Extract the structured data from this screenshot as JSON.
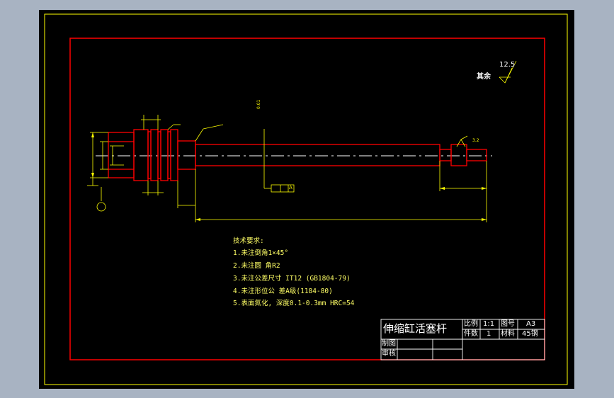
{
  "drawing": {
    "surface_finish": {
      "label": "其余",
      "value": "12.5"
    },
    "end_finish": "3.2",
    "tolerance_frame_value": "0.01",
    "section_mark": "A",
    "technical_requirements": {
      "title": "技术要求:",
      "items": [
        "1.未注倒角1×45°",
        "2.未注圆 角R2",
        "3.未注公差尺寸 IT12 (GB1804-79)",
        "4.未注形位公 差A级(1184-80)",
        "5.表面氮化, 深度0.1-0.3mm HRC=54"
      ]
    },
    "title_block": {
      "title": "伸缩缸活塞杆",
      "scale_label": "比例",
      "scale_value": "1:1",
      "drawing_no_label": "图号",
      "drawing_no_value": "A3",
      "quantity_label": "件数",
      "quantity_value": "1",
      "material_label": "材料",
      "material_value": "45钢",
      "drawn_by_label": "制图",
      "checked_by_label": "审核"
    }
  },
  "colors": {
    "background": "#000000",
    "outer_frame": "#ffff00",
    "inner_frame": "#ff0000",
    "dimensions": "#ffff00",
    "text": "#ffffff"
  }
}
